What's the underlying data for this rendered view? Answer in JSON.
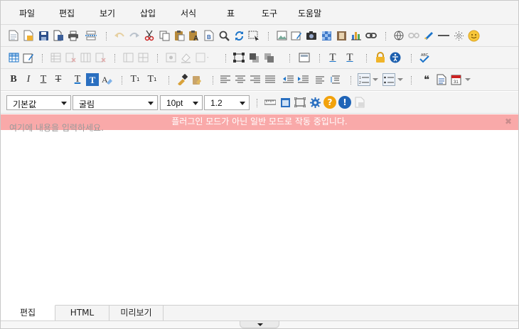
{
  "menu": [
    "파일",
    "편집",
    "보기",
    "삽입",
    "서식",
    "표",
    "도구",
    "도움말"
  ],
  "format": {
    "style": "기본값",
    "font": "굴림",
    "size": "10pt",
    "line_height": "1.2"
  },
  "notice": {
    "text": "플러그인 모드가 아닌 일반 모드로 작동 중입니다.",
    "close": "✖"
  },
  "editor": {
    "placeholder": "여기에 내용을 입력하세요."
  },
  "tabs": [
    "편집",
    "HTML",
    "미리보기"
  ],
  "toolbar_text": {
    "bold": "B",
    "italic": "I",
    "underline": "T",
    "strike": "T",
    "font_color": "T",
    "highlight": "T",
    "subscript": "T",
    "superscript": "T",
    "subscript_mark": "1",
    "superscript_mark": "1",
    "quote": "❝",
    "emoji": "☺",
    "help": "?",
    "info": "!"
  },
  "colors": {
    "accent": "#1c74c9",
    "notice_bg": "#f9a9a9",
    "help": "#f2a20c",
    "info": "#1f64b7"
  }
}
